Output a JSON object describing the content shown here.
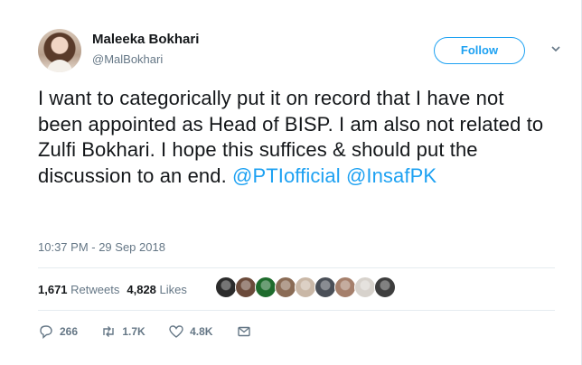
{
  "author": {
    "name": "Maleeka Bokhari",
    "handle": "@MalBokhari"
  },
  "follow_button": {
    "label": "Follow"
  },
  "tweet": {
    "text_parts": [
      "I want to categorically put it on record that I have not been appointed as Head of BISP.  I am also not related to Zulfi Bokhari.  I hope this suffices & should put the discussion to an end.  ",
      "@PTIofficial",
      " ",
      "@InsafPK"
    ],
    "timestamp": "10:37 PM - 29 Sep 2018"
  },
  "stats": {
    "retweets_count": "1,671",
    "retweets_label": "Retweets",
    "likes_count": "4,828",
    "likes_label": "Likes"
  },
  "likers": [
    {
      "name": "liker-1",
      "color": "#2b2b2b"
    },
    {
      "name": "liker-2",
      "color": "#6b4a3a"
    },
    {
      "name": "liker-3",
      "color": "#1e6b2c"
    },
    {
      "name": "liker-4",
      "color": "#8a6b55"
    },
    {
      "name": "liker-5",
      "color": "#c9b7a6"
    },
    {
      "name": "liker-6",
      "color": "#4a4f57"
    },
    {
      "name": "liker-7",
      "color": "#a57f6b"
    },
    {
      "name": "liker-8",
      "color": "#d7d2cc"
    },
    {
      "name": "liker-9",
      "color": "#3d3d3d"
    }
  ],
  "actions": {
    "replies": "266",
    "retweets": "1.7K",
    "likes": "4.8K"
  },
  "colors": {
    "accent": "#1da1f2",
    "muted": "#657786",
    "text": "#14171a"
  }
}
